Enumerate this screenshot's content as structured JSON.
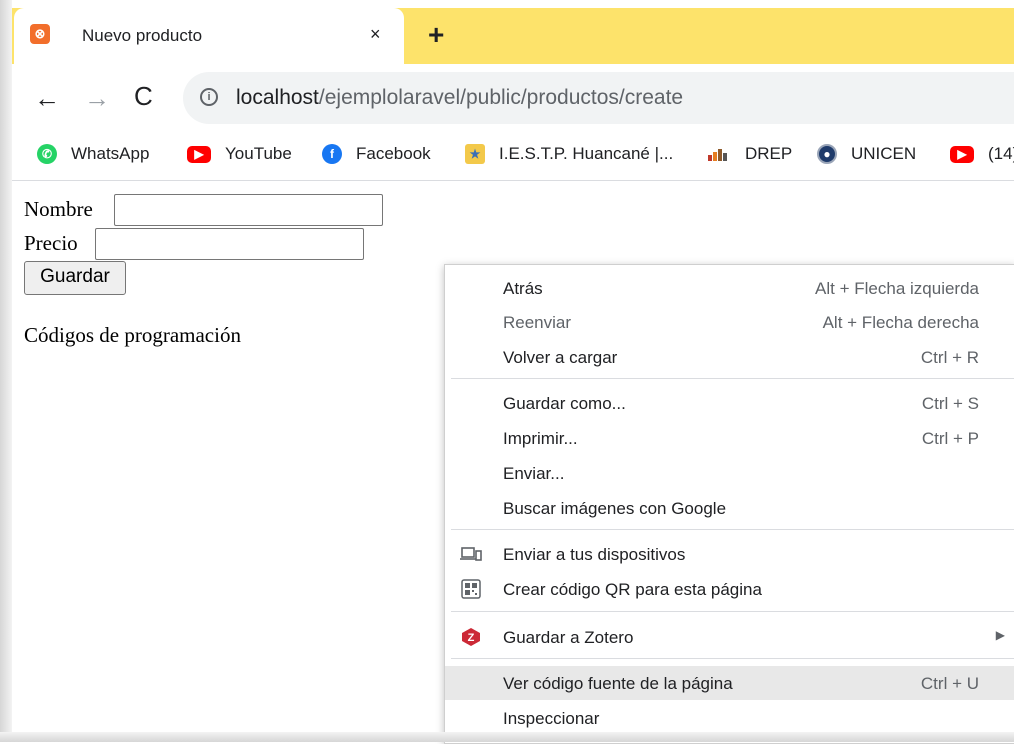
{
  "tab": {
    "title": "Nuevo producto",
    "close": "×",
    "new_tab": "+"
  },
  "toolbar": {
    "back": "←",
    "forward": "→",
    "reload": "C",
    "url_host": "localhost",
    "url_path": "/ejemplolaravel/public/productos/create"
  },
  "bookmarks": [
    {
      "label": "WhatsApp",
      "icon": "whatsapp-icon",
      "color": "#25d366"
    },
    {
      "label": "YouTube",
      "icon": "youtube-icon",
      "color": "#ff0000"
    },
    {
      "label": "Facebook",
      "icon": "facebook-icon",
      "color": "#1877f2"
    },
    {
      "label": "I.E.S.T.P. Huancané |...",
      "icon": "school-icon",
      "color": "#3b6fb6"
    },
    {
      "label": "DREP",
      "icon": "drep-icon",
      "color": "#b5651d"
    },
    {
      "label": "UNICEN",
      "icon": "unicen-icon",
      "color": "#1f3b6b"
    },
    {
      "label": "(14)",
      "icon": "youtube-icon",
      "color": "#ff0000"
    }
  ],
  "form": {
    "nombre_label": "Nombre",
    "precio_label": "Precio",
    "guardar_label": "Guardar",
    "codigos_text": "Códigos de programación"
  },
  "context_menu": {
    "items": [
      {
        "label": "Atrás",
        "shortcut": "Alt + Flecha izquierda"
      },
      {
        "label": "Reenviar",
        "shortcut": "Alt + Flecha derecha"
      },
      {
        "label": "Volver a cargar",
        "shortcut": "Ctrl + R"
      },
      {
        "label": "Guardar como...",
        "shortcut": "Ctrl + S"
      },
      {
        "label": "Imprimir...",
        "shortcut": "Ctrl + P"
      },
      {
        "label": "Enviar...",
        "shortcut": ""
      },
      {
        "label": "Buscar imágenes con Google",
        "shortcut": ""
      },
      {
        "label": "Enviar a tus dispositivos",
        "shortcut": ""
      },
      {
        "label": "Crear código QR para esta página",
        "shortcut": ""
      },
      {
        "label": "Guardar a Zotero",
        "shortcut": ""
      },
      {
        "label": "Ver código fuente de la página",
        "shortcut": "Ctrl + U"
      },
      {
        "label": "Inspeccionar",
        "shortcut": ""
      }
    ]
  }
}
